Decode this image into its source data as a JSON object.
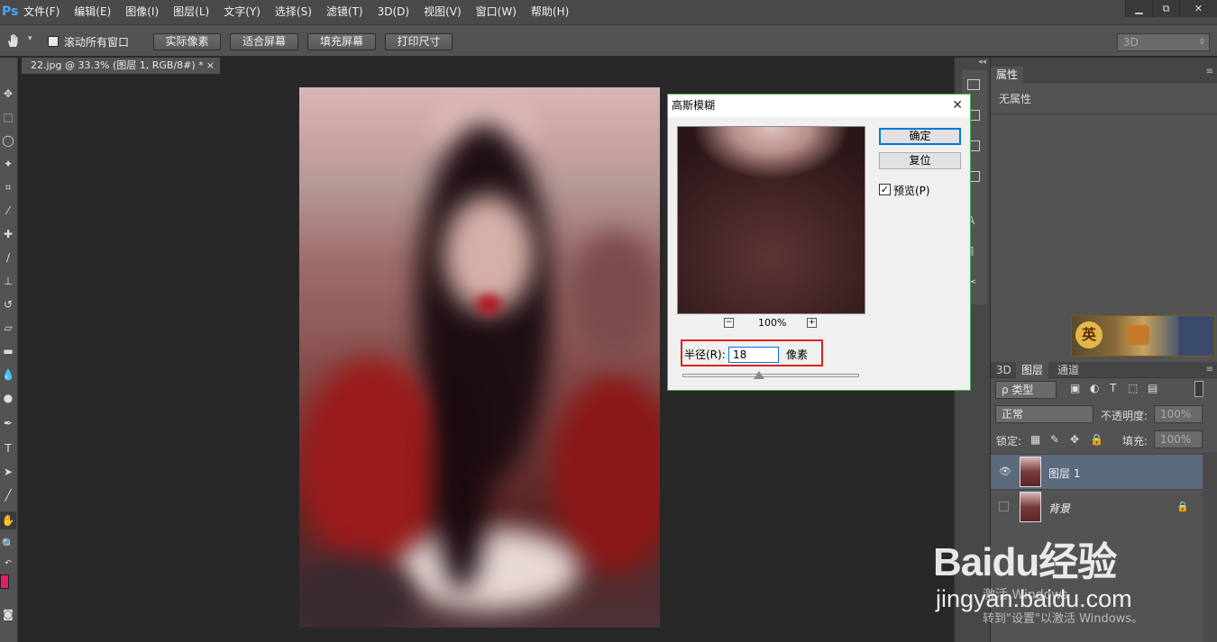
{
  "menubar": {
    "logo": "Ps",
    "items": [
      "文件(F)",
      "编辑(E)",
      "图像(I)",
      "图层(L)",
      "文字(Y)",
      "选择(S)",
      "滤镜(T)",
      "3D(D)",
      "视图(V)",
      "窗口(W)",
      "帮助(H)"
    ],
    "window_controls": [
      "▁",
      "⧉",
      "✕"
    ]
  },
  "options": {
    "scroll_all_label": "滚动所有窗口",
    "buttons": [
      "实际像素",
      "适合屏幕",
      "填充屏幕",
      "打印尺寸"
    ],
    "workspace_select": "3D"
  },
  "document_tab": {
    "title": "22.jpg @ 33.3% (图层 1, RGB/8#) *",
    "close": "×"
  },
  "properties_panel": {
    "tab": "属性",
    "content": "无属性"
  },
  "layers_panel": {
    "tabs": [
      "3D",
      "图层",
      "通道"
    ],
    "filter_kind": "ρ 类型",
    "blend_mode": "正常",
    "opacity_label": "不透明度:",
    "opacity_value": "100%",
    "lock_label": "锁定:",
    "fill_label": "填充:",
    "fill_value": "100%",
    "layers": [
      {
        "name": "图层 1",
        "visible": true,
        "selected": true
      },
      {
        "name": "背景",
        "visible": false,
        "locked": true
      }
    ]
  },
  "dialog": {
    "title": "高斯模糊",
    "ok_label": "确定",
    "reset_label": "复位",
    "preview_label": "预览(P)",
    "preview_checked": true,
    "zoom": "100%",
    "zoom_out": "−",
    "zoom_in": "+",
    "radius_label": "半径(R):",
    "radius_value": "18",
    "radius_unit": "像素"
  },
  "watermark": {
    "logo": "Baidu经验",
    "url": "jingyan.baidu.com",
    "activate_line1": "激活 Windows",
    "activate_line2": "转到\"设置\"以激活 Windows。"
  },
  "colors": {
    "foreground": "#e0206a",
    "background": "#f2c800",
    "accent": "#0078d7",
    "highlight_box": "#e02020"
  }
}
